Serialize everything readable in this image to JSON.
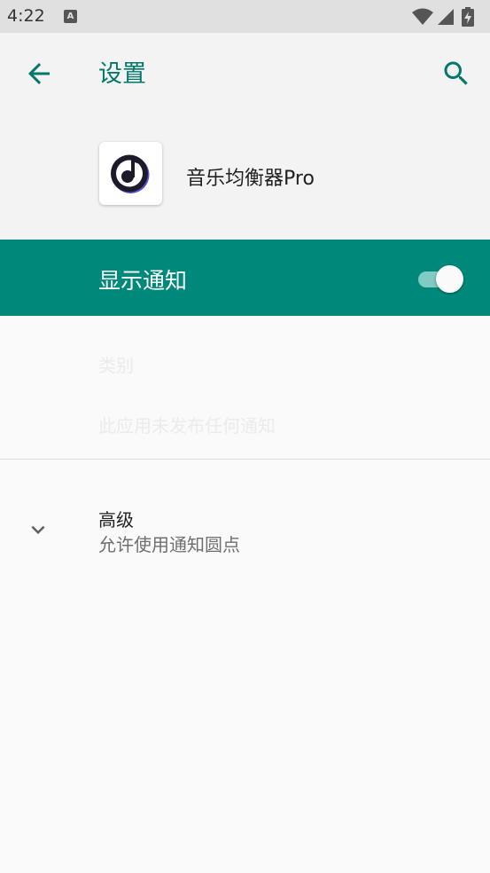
{
  "status_bar": {
    "time": "4:22",
    "notification_glyph": "A",
    "icons": [
      "wifi-icon",
      "cell-signal-icon",
      "battery-charging-icon"
    ]
  },
  "app_bar": {
    "title": "设置",
    "back_icon": "arrow-back-icon",
    "search_icon": "search-icon"
  },
  "app_info": {
    "name": "音乐均衡器Pro",
    "icon": "music-note-app-icon"
  },
  "notifications": {
    "label": "显示通知",
    "enabled": true
  },
  "category": {
    "title": "类别",
    "empty_text": "此应用未发布任何通知"
  },
  "advanced": {
    "title": "高级",
    "summary": "允许使用通知圆点"
  },
  "colors": {
    "accent": "#00796b",
    "bar": "#00897b",
    "toggle_track": "#80cbc4"
  }
}
